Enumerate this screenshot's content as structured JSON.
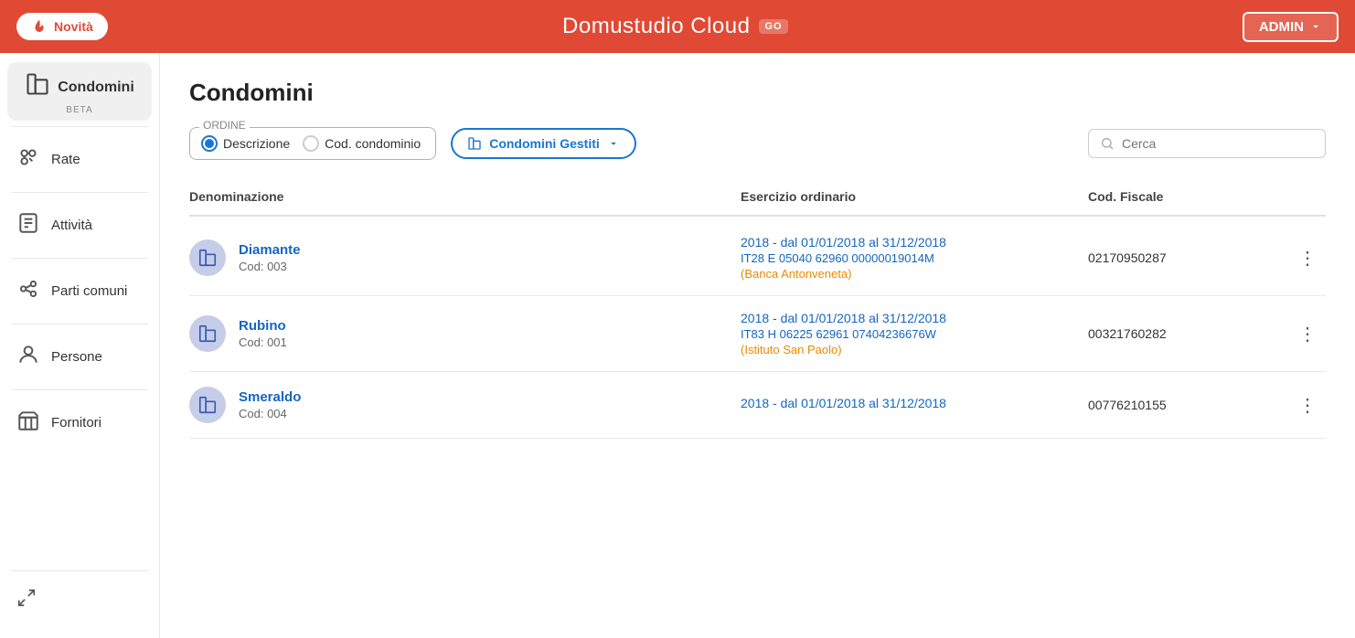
{
  "header": {
    "novita_label": "Novità",
    "title": "Domustudio Cloud",
    "go_badge": "GO",
    "admin_label": "ADMIN"
  },
  "sidebar": {
    "items": [
      {
        "id": "condomini",
        "label": "Condomini",
        "badge": "BETA",
        "active": true
      },
      {
        "id": "rate",
        "label": "Rate",
        "active": false
      },
      {
        "id": "attivita",
        "label": "Attività",
        "active": false
      },
      {
        "id": "parti-comuni",
        "label": "Parti comuni",
        "active": false
      },
      {
        "id": "persone",
        "label": "Persone",
        "active": false
      },
      {
        "id": "fornitori",
        "label": "Fornitori",
        "active": false
      }
    ]
  },
  "main": {
    "page_title": "Condomini",
    "ordine_legend": "ORDINE",
    "ordine_options": [
      {
        "id": "descrizione",
        "label": "Descrizione",
        "selected": true
      },
      {
        "id": "cod",
        "label": "Cod. condominio",
        "selected": false
      }
    ],
    "filter_dropdown_label": "Condomini Gestiti",
    "search_placeholder": "Cerca",
    "table_headers": [
      "Denominazione",
      "Esercizio ordinario",
      "Cod. Fiscale",
      ""
    ],
    "rows": [
      {
        "id": "diamante",
        "name": "Diamante",
        "cod": "Cod: 003",
        "exercise_link": "2018 - dal 01/01/2018 al 31/12/2018",
        "iban": "IT28 E 05040 62960 00000019014M",
        "bank": "(Banca Antonveneta)",
        "fiscal_code": "02170950287"
      },
      {
        "id": "rubino",
        "name": "Rubino",
        "cod": "Cod: 001",
        "exercise_link": "2018 - dal 01/01/2018 al 31/12/2018",
        "iban": "IT83 H 06225 62961 07404236676W",
        "bank": "(Istituto San Paolo)",
        "fiscal_code": "00321760282"
      },
      {
        "id": "smeraldo",
        "name": "Smeraldo",
        "cod": "Cod: 004",
        "exercise_link": "2018 - dal 01/01/2018 al 31/12/2018",
        "iban": "",
        "bank": "",
        "fiscal_code": "00776210155"
      }
    ]
  }
}
